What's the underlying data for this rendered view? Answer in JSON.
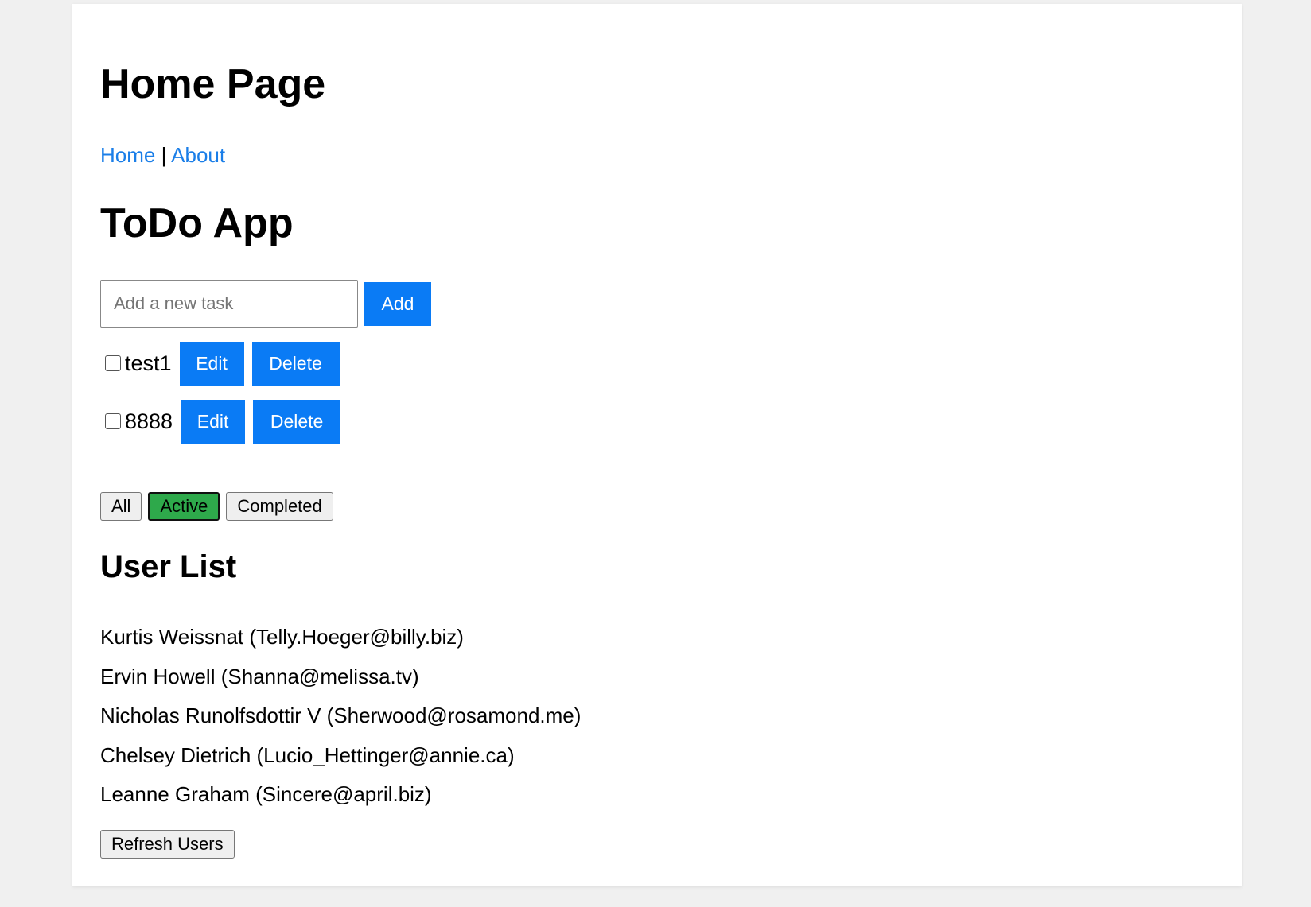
{
  "header": {
    "title": "Home Page",
    "nav": {
      "home": "Home",
      "separator": "|",
      "about": "About"
    }
  },
  "todo": {
    "title": "ToDo App",
    "input": {
      "placeholder": "Add a new task",
      "value": ""
    },
    "add_label": "Add",
    "items": [
      {
        "text": "test1",
        "checked": false,
        "edit_label": "Edit",
        "delete_label": "Delete"
      },
      {
        "text": "8888",
        "checked": false,
        "edit_label": "Edit",
        "delete_label": "Delete"
      }
    ],
    "filters": {
      "all": "All",
      "active": "Active",
      "completed": "Completed",
      "selected": "Active"
    }
  },
  "users": {
    "title": "User List",
    "items": [
      "Kurtis Weissnat (Telly.Hoeger@billy.biz)",
      "Ervin Howell (Shanna@melissa.tv)",
      "Nicholas Runolfsdottir V (Sherwood@rosamond.me)",
      "Chelsey Dietrich (Lucio_Hettinger@annie.ca)",
      "Leanne Graham (Sincere@april.biz)"
    ],
    "refresh_label": "Refresh Users"
  },
  "colors": {
    "link": "#1a7ee8",
    "primary_button": "#0a7bf5",
    "active_filter": "#2ea94b",
    "page_background": "#f0f0f0",
    "card_background": "#ffffff"
  }
}
